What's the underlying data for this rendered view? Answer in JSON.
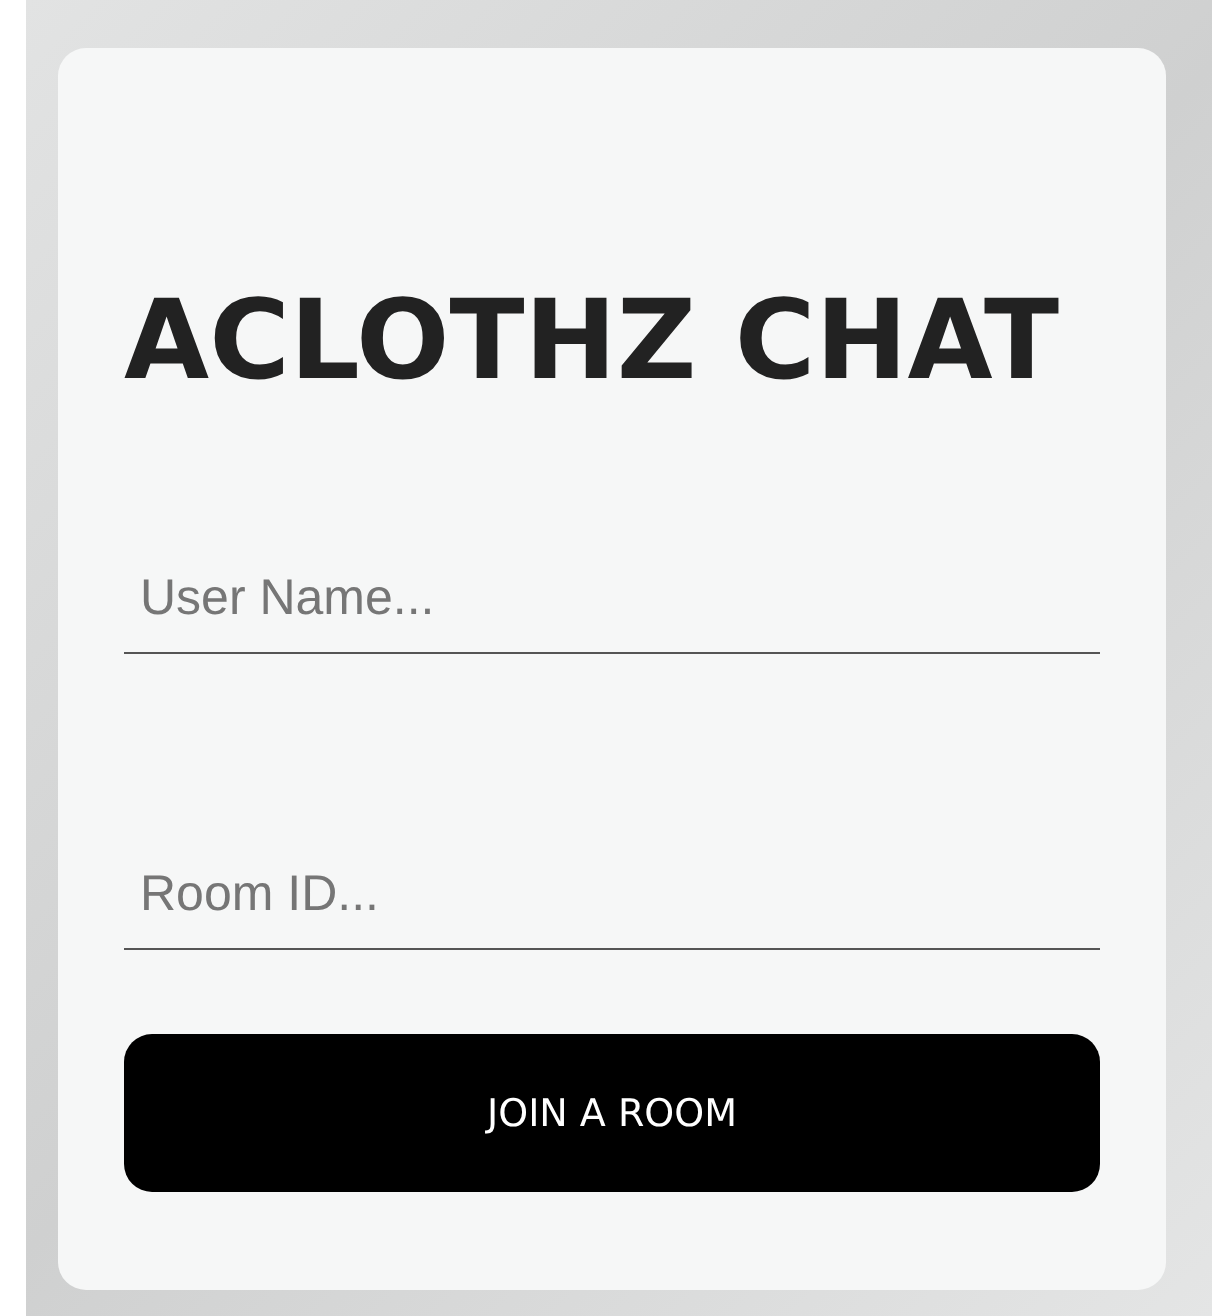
{
  "title": "ACLOTHZ CHAT",
  "fields": [
    {
      "placeholder": "User Name..."
    },
    {
      "placeholder": "Room ID..."
    }
  ],
  "button": "JOIN A ROOM"
}
